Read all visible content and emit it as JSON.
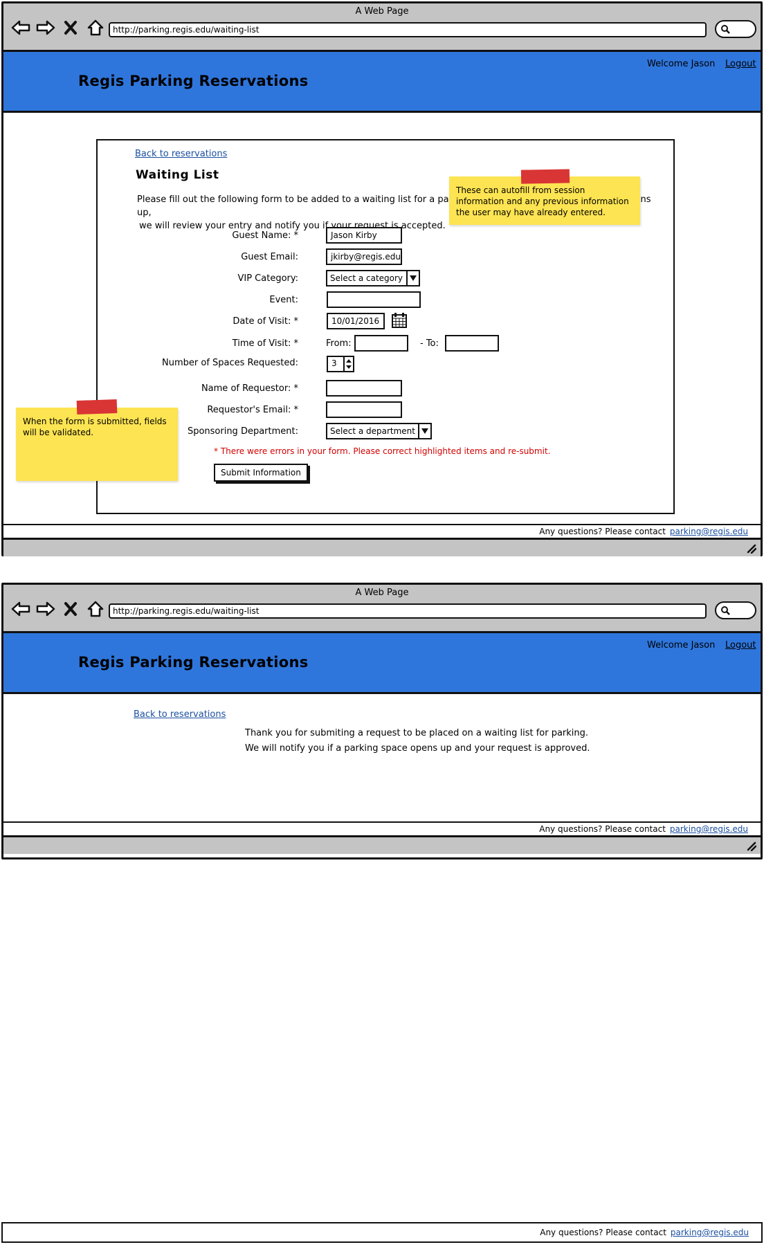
{
  "browser": {
    "window_title": "A Web Page",
    "url": "http://parking.regis.edu/waiting-list"
  },
  "site": {
    "title": "Regis Parking Reservations",
    "welcome": "Welcome Jason",
    "logout": "Logout",
    "banner_color": "#2f76dc"
  },
  "footer": {
    "text": "Any questions? Please contact",
    "email": "parking@regis.edu"
  },
  "form_page": {
    "back_link": "Back to reservations",
    "heading": "Waiting List",
    "intro_line1": "Please fill out the following form to be added to a waiting list for a parking reserveration. If a parking space opens up,",
    "intro_line2": "we will review your entry and notify you if your request is accepted.",
    "fields": {
      "guest_name": {
        "label": "Guest Name: *",
        "value": "Jason Kirby"
      },
      "guest_email": {
        "label": "Guest Email:",
        "value": "jkirby@regis.edu"
      },
      "vip_category": {
        "label": "VIP Category:",
        "value": "Select a category"
      },
      "event": {
        "label": "Event:",
        "value": ""
      },
      "date_of_visit": {
        "label": "Date of Visit: *",
        "value": "10/01/2016"
      },
      "time_of_visit": {
        "label": "Time of Visit: *",
        "from_label": "From:",
        "to_label": "- To:",
        "from_value": "",
        "to_value": ""
      },
      "num_spaces": {
        "label": "Number of Spaces Requested:",
        "value": "3"
      },
      "requestor_name": {
        "label": "Name of Requestor: *",
        "value": ""
      },
      "requestor_email": {
        "label": "Requestor's Email: *",
        "value": ""
      },
      "department": {
        "label": "Sponsoring Department:",
        "value": "Select a department"
      }
    },
    "error_message": "* There were errors in your form. Please correct highlighted items and re-submit.",
    "submit_label": "Submit Information",
    "note_autofill": "These can autofill from session information and any previous information the user may have already entered.",
    "note_validation": "When the form is submitted, fields will be validated."
  },
  "confirm_page": {
    "back_link": "Back to reservations",
    "line1": "Thank you for submiting a request to be placed on a waiting list for parking.",
    "line2": "We will notify you if a parking space opens up and your request is approved."
  },
  "colors": {
    "error": "#d40000",
    "sticky": "#fde452",
    "tape": "#d93535",
    "chrome": "#c4c4c4",
    "link": "#1b4fa0"
  },
  "icons": [
    "back-arrow-icon",
    "forward-arrow-icon",
    "close-icon",
    "home-icon",
    "search-icon",
    "calendar-icon",
    "dropdown-arrow-icon",
    "spinner-arrows-icon",
    "resize-grip-icon"
  ]
}
